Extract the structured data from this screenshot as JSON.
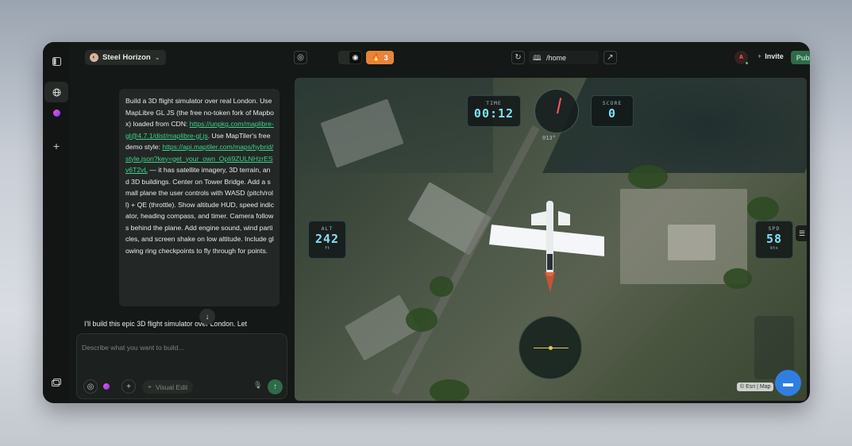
{
  "project": {
    "name": "Steel Horizon"
  },
  "toolbar": {
    "badge_count": "3",
    "url_path": "/home",
    "invite_label": "Invite",
    "publish_label": "Publish",
    "avatar_initial": "A"
  },
  "chat": {
    "message_parts": {
      "p1": "Build a 3D flight simulator over real London. Use MapLibre GL JS (the free no-token fork of Mapbox) loaded from CDN: ",
      "link1": "https://unpkg.com/maplibre-gl@4.7.1/dist/maplibre-gl.js",
      "p2": ". Use MapTiler's free demo style: ",
      "link2": "https://api.maptiler.com/maps/hybrid/style.json?key=get_your_own_OpIi9ZULNHzrESv6T2vL",
      "p3": " — it has satellite imagery, 3D terrain, and 3D buildings. Center on Tower Bridge. Add a small plane the user controls with WASD (pitch/roll) + QE (throttle). Show altitude HUD, speed indicator, heading compass, and timer. Camera follows behind the plane. Add engine sound, wind particles, and screen shake on low altitude. Include glowing ring checkpoints to fly through for points."
    },
    "reply_preview": "I'll build this epic 3D flight simulator over London. Let",
    "composer_placeholder": "Describe what you want to build...",
    "visual_edit_label": "Visual Edit"
  },
  "hud": {
    "time_label": "TIME",
    "time_value": "00:12",
    "score_label": "SCORE",
    "score_value": "0",
    "heading_value": "013°",
    "alt_label": "ALT",
    "alt_value": "242",
    "alt_unit": "ft",
    "spd_label": "SPD",
    "spd_value": "58",
    "spd_unit": "kts"
  },
  "map": {
    "attribution": "© Esri | Map"
  },
  "colors": {
    "accent_green": "#2f6b4a",
    "badge_orange": "#e8843b",
    "hud_cyan": "#7fe0f5"
  }
}
